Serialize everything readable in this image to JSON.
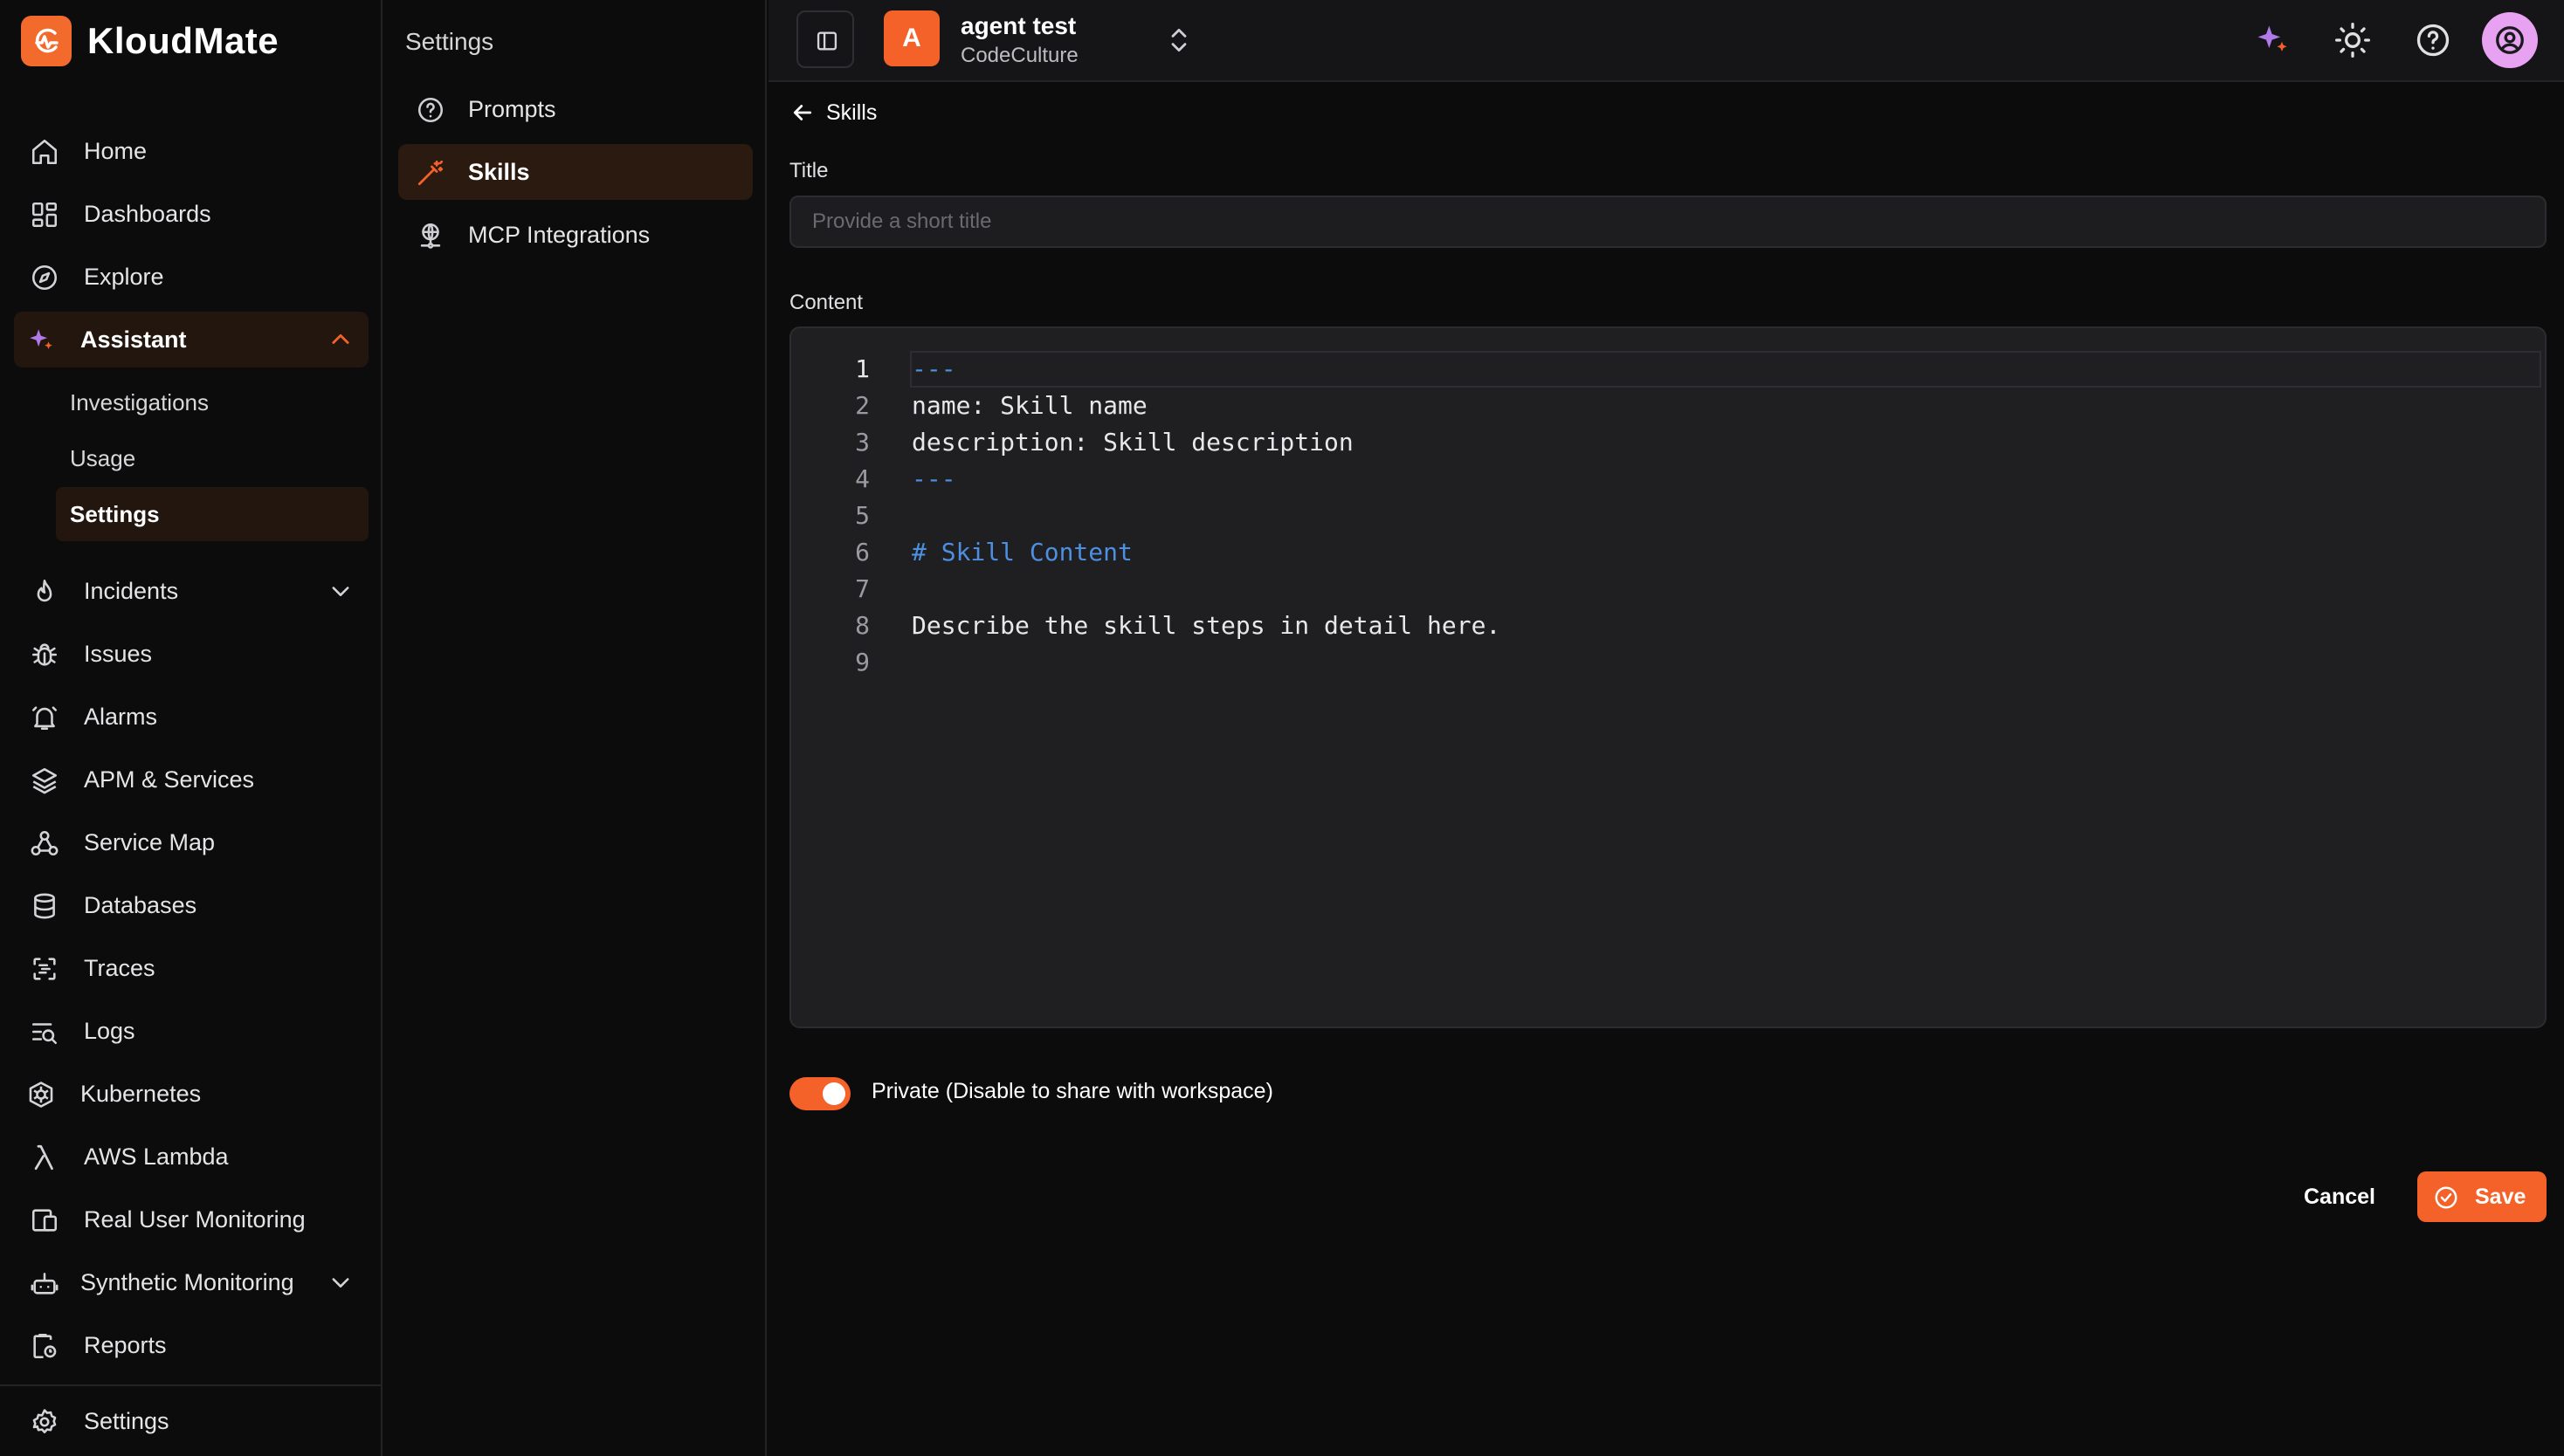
{
  "brand": {
    "name": "KloudMate",
    "logo_icon": "kloudmate-logo-icon",
    "color": "#f26b2c"
  },
  "sidebar": {
    "items": [
      {
        "label": "Home",
        "icon": "home-icon"
      },
      {
        "label": "Dashboards",
        "icon": "grid-icon"
      },
      {
        "label": "Explore",
        "icon": "compass-icon"
      },
      {
        "label": "Assistant",
        "icon": "sparkle-icon",
        "expanded": true,
        "children": [
          {
            "label": "Investigations"
          },
          {
            "label": "Usage"
          },
          {
            "label": "Settings",
            "active": true
          }
        ]
      },
      {
        "label": "Incidents",
        "icon": "flame-icon",
        "expanded": false
      },
      {
        "label": "Issues",
        "icon": "bug-icon"
      },
      {
        "label": "Alarms",
        "icon": "bell-icon"
      },
      {
        "label": "APM & Services",
        "icon": "layers-icon"
      },
      {
        "label": "Service Map",
        "icon": "service-map-icon"
      },
      {
        "label": "Databases",
        "icon": "database-icon"
      },
      {
        "label": "Traces",
        "icon": "traces-icon"
      },
      {
        "label": "Logs",
        "icon": "logs-icon"
      },
      {
        "label": "Kubernetes",
        "icon": "kubernetes-icon"
      },
      {
        "label": "AWS Lambda",
        "icon": "lambda-icon"
      },
      {
        "label": "Real User Monitoring",
        "icon": "devices-icon"
      },
      {
        "label": "Synthetic Monitoring",
        "icon": "robot-icon",
        "expanded": false
      },
      {
        "label": "Reports",
        "icon": "report-icon"
      }
    ],
    "footer": {
      "label": "Settings",
      "icon": "gear-icon"
    }
  },
  "settings_panel": {
    "title": "Settings",
    "items": [
      {
        "label": "Prompts",
        "icon": "question-circle-icon"
      },
      {
        "label": "Skills",
        "icon": "magic-wand-icon",
        "active": true
      },
      {
        "label": "MCP Integrations",
        "icon": "network-icon"
      }
    ]
  },
  "topbar": {
    "workspace": {
      "initial": "A",
      "name": "agent test",
      "org": "CodeCulture",
      "color": "#f4622a"
    },
    "icons": [
      "sparkle-icon",
      "sun-icon",
      "help-icon",
      "user-avatar-icon"
    ]
  },
  "form": {
    "back_label": "Skills",
    "title_label": "Title",
    "title_placeholder": "Provide a short title",
    "title_value": "",
    "content_label": "Content",
    "content_lines": [
      {
        "num": "1",
        "text": "---"
      },
      {
        "num": "2",
        "text": "name: Skill name"
      },
      {
        "num": "3",
        "text": "description: Skill description"
      },
      {
        "num": "4",
        "text": "---"
      },
      {
        "num": "5",
        "text": ""
      },
      {
        "num": "6",
        "text": "# Skill Content"
      },
      {
        "num": "7",
        "text": ""
      },
      {
        "num": "8",
        "text": "Describe the skill steps in detail here."
      },
      {
        "num": "9",
        "text": ""
      }
    ],
    "private_label": "Private (Disable to share with workspace)",
    "private_enabled": true,
    "cancel_label": "Cancel",
    "save_label": "Save"
  },
  "colors": {
    "accent": "#f4622a",
    "background": "#0c0c0d",
    "code_keyword": "#4d8fe0"
  }
}
